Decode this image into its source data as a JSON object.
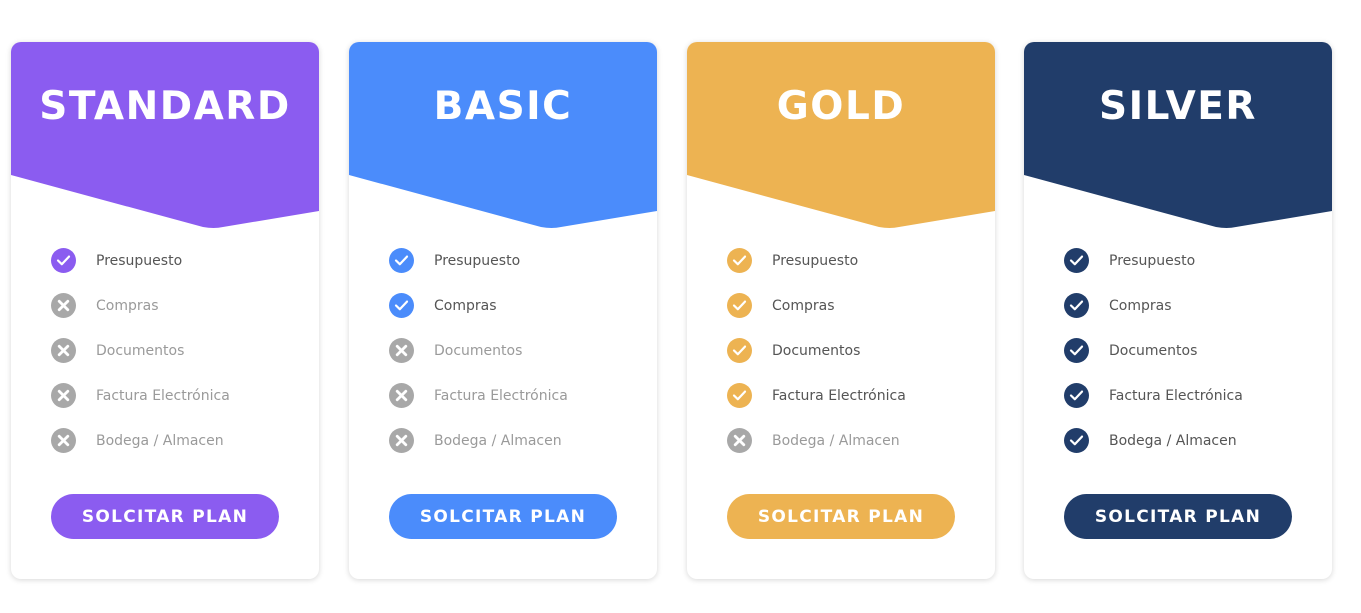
{
  "plans": [
    {
      "name": "STANDARD",
      "color": "#8b5cf0",
      "button_label": "SOLCITAR PLAN",
      "features": [
        {
          "label": "Presupuesto",
          "included": true
        },
        {
          "label": "Compras",
          "included": false
        },
        {
          "label": "Documentos",
          "included": false
        },
        {
          "label": "Factura Electrónica",
          "included": false
        },
        {
          "label": "Bodega / Almacen",
          "included": false
        }
      ]
    },
    {
      "name": "BASIC",
      "color": "#4b8cfb",
      "button_label": "SOLCITAR PLAN",
      "features": [
        {
          "label": "Presupuesto",
          "included": true
        },
        {
          "label": "Compras",
          "included": true
        },
        {
          "label": "Documentos",
          "included": false
        },
        {
          "label": "Factura Electrónica",
          "included": false
        },
        {
          "label": "Bodega / Almacen",
          "included": false
        }
      ]
    },
    {
      "name": "GOLD",
      "color": "#edb352",
      "button_label": "SOLCITAR PLAN",
      "features": [
        {
          "label": "Presupuesto",
          "included": true
        },
        {
          "label": "Compras",
          "included": true
        },
        {
          "label": "Documentos",
          "included": true
        },
        {
          "label": "Factura Electrónica",
          "included": true
        },
        {
          "label": "Bodega / Almacen",
          "included": false
        }
      ]
    },
    {
      "name": "SILVER",
      "color": "#213d6a",
      "button_label": "SOLCITAR PLAN",
      "features": [
        {
          "label": "Presupuesto",
          "included": true
        },
        {
          "label": "Compras",
          "included": true
        },
        {
          "label": "Documentos",
          "included": true
        },
        {
          "label": "Factura Electrónica",
          "included": true
        },
        {
          "label": "Bodega / Almacen",
          "included": true
        }
      ]
    }
  ],
  "icons": {
    "included": "check-icon",
    "excluded": "x-icon"
  }
}
